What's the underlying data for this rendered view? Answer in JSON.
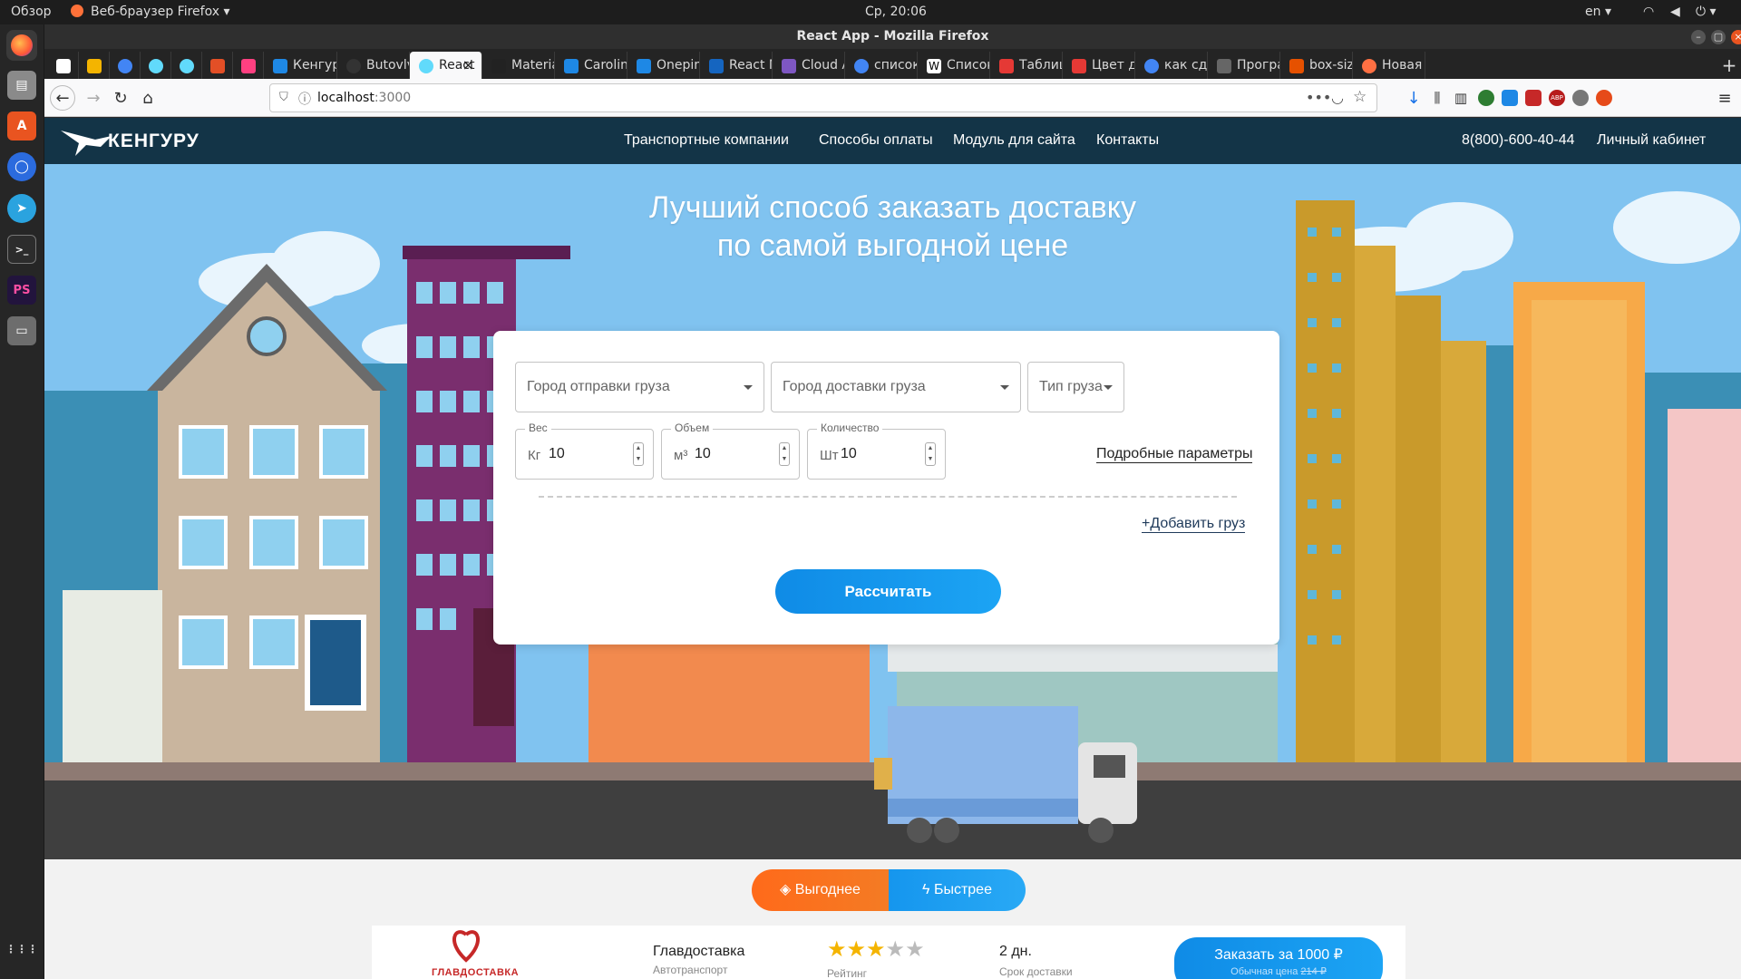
{
  "os": {
    "activities": "Обзор",
    "app_menu": "Веб-браузер Firefox",
    "clock": "Ср, 20:06",
    "keyboard_layout": "en"
  },
  "window": {
    "title": "React App - Mozilla Firefox"
  },
  "tabs": [
    {
      "label": "",
      "color": "#ffffff"
    },
    {
      "label": "",
      "color": "#f4b400"
    },
    {
      "label": "",
      "color": "#4285f4"
    },
    {
      "label": "",
      "color": "#61dafb"
    },
    {
      "label": "",
      "color": "#61dafb"
    },
    {
      "label": "",
      "color": "#e34f26"
    },
    {
      "label": "",
      "color": "#ff4081"
    },
    {
      "label": "Кенгуру",
      "color": "#1e88e5"
    },
    {
      "label": "Butovlv",
      "color": "#333333"
    },
    {
      "label": "React",
      "color": "#61dafb",
      "active": true
    },
    {
      "label": "Materia",
      "color": "#222222"
    },
    {
      "label": "Carolina",
      "color": "#1e88e5"
    },
    {
      "label": "Onepira",
      "color": "#1e88e5"
    },
    {
      "label": "React M",
      "color": "#1565c0"
    },
    {
      "label": "Cloud A",
      "color": "#7e57c2"
    },
    {
      "label": "список",
      "color": "#4285f4"
    },
    {
      "label": "Список",
      "color": "#333333"
    },
    {
      "label": "Таблиц",
      "color": "#e53935"
    },
    {
      "label": "Цвет д",
      "color": "#e53935"
    },
    {
      "label": "как сде",
      "color": "#4285f4"
    },
    {
      "label": "Програ",
      "color": "#666666"
    },
    {
      "label": "box-sizi",
      "color": "#e65100"
    },
    {
      "label": "Новая в",
      "color": "#ff7043"
    }
  ],
  "navbar": {
    "url_host": "localhost",
    "url_port": ":3000"
  },
  "site": {
    "logo": "КЕНГУРУ",
    "nav": [
      "Транспортные компании",
      "Способы оплаты",
      "Модуль для сайта",
      "Контакты"
    ],
    "phone": "8(800)-600-40-44",
    "account": "Личный кабинет",
    "hero_line1": "Лучший способ заказать доставку",
    "hero_line2": "по самой выгодной цене"
  },
  "form": {
    "from_city": "Город отправки груза",
    "to_city": "Город доставки груза",
    "cargo_type": "Тип груза",
    "weight_label": "Вес",
    "weight_unit": "Кг",
    "weight_value": "10",
    "volume_label": "Объем",
    "volume_unit": "м³",
    "volume_value": "10",
    "qty_label": "Количество",
    "qty_unit": "Шт",
    "qty_value": "10",
    "more_params": "Подробные параметры",
    "add_cargo": "Добавить груз",
    "calculate": "Рассчитать"
  },
  "toggle": {
    "cheaper": "Выгоднее",
    "faster": "Быстрее"
  },
  "result": {
    "company_logo_text": "ГЛАВДОСТАВКА",
    "company": "Главдоставка",
    "company_type": "Автотранспорт",
    "rating": 3,
    "rating_max": 5,
    "rating_label": "Рейтинг",
    "delivery_days": "2 дн.",
    "delivery_label": "Срок доставки",
    "order_label": "Заказать за 1000 ₽",
    "regular_price_label": "Обычная цена",
    "regular_price": "214 ₽"
  }
}
